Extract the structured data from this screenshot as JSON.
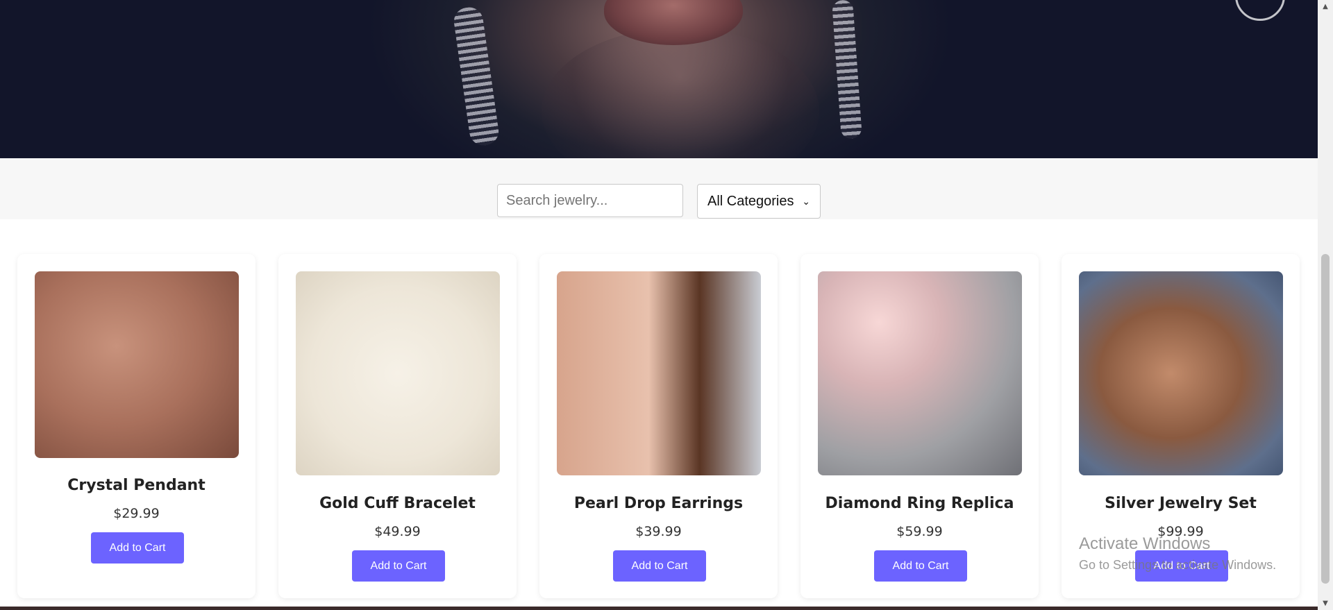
{
  "search": {
    "placeholder": "Search jewelry..."
  },
  "category_select": {
    "selected": "All Categories"
  },
  "products": [
    {
      "name": "Crystal Pendant",
      "price": "$29.99",
      "button": "Add to Cart"
    },
    {
      "name": "Gold Cuff Bracelet",
      "price": "$49.99",
      "button": "Add to Cart"
    },
    {
      "name": "Pearl Drop Earrings",
      "price": "$39.99",
      "button": "Add to Cart"
    },
    {
      "name": "Diamond Ring Replica",
      "price": "$59.99",
      "button": "Add to Cart"
    },
    {
      "name": "Silver Jewelry Set",
      "price": "$99.99",
      "button": "Add to Cart"
    }
  ],
  "watermark": {
    "title": "Activate Windows",
    "subtitle": "Go to Settings to activate Windows."
  },
  "colors": {
    "accent": "#6c63ff",
    "filter_bar_bg": "#f7f7f7"
  },
  "icons": {
    "select": "chevron-down-icon",
    "scroll_up": "scroll-up-icon",
    "scroll_down": "scroll-down-icon"
  }
}
